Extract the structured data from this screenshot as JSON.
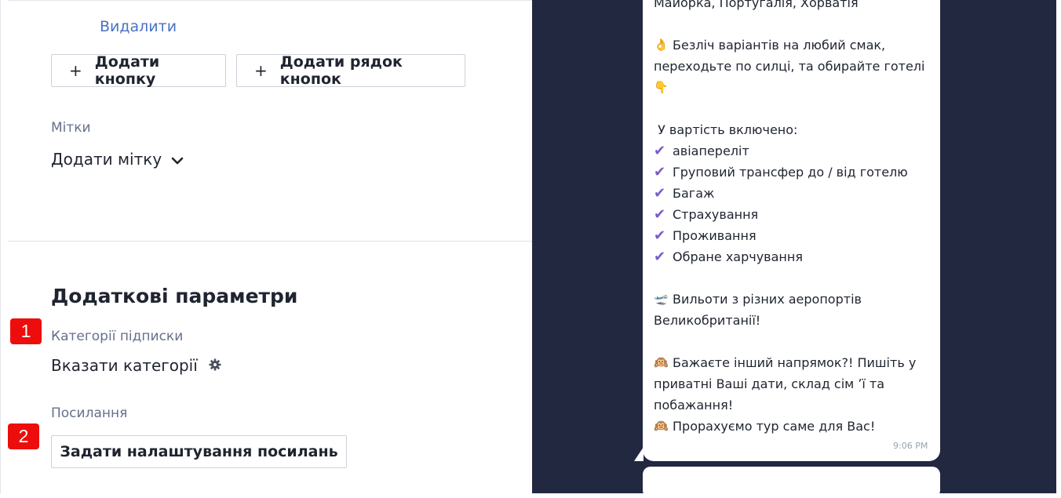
{
  "editor": {
    "delete_link": "Видалити",
    "add_button": "Додати кнопку",
    "add_button_row": "Додати рядок кнопок",
    "tags_label": "Мітки",
    "add_tag": "Додати мітку",
    "section_title": "Додаткові параметри",
    "categories_label": "Категорії підписки",
    "categories_value": "Вказати категорії",
    "links_label": "Посилання",
    "links_button": "Задати налаштування посилань",
    "plus_glyph": "+"
  },
  "badges": [
    "1",
    "2"
  ],
  "preview": {
    "lines": {
      "l0": "Майорка, Португалія, Хорватія",
      "l1_emoji": "👌",
      "l1": "Безліч варіантів на любий смак,",
      "l2": "переходьте по силці, та обирайте готелі",
      "l3_emoji": "👇",
      "l4": " У вартість включено:",
      "items": [
        "авіапереліт",
        "Груповий трансфер до / від готелю",
        "Багаж",
        "Страхування",
        "Проживання",
        "Обране харчування"
      ],
      "l5_emoji": "🛫",
      "l5": "Вильоти з різних аеропортів",
      "l6": "Великобританії!",
      "l7_emoji": "🙉",
      "l7": "Бажаєте інший напрямок?! Пишіть у",
      "l8": "приватні Ваші дати, склад сім ʼї та",
      "l9": "побажання!",
      "l10_emoji": "🙉",
      "l10": "Прорахуємо тур саме для Вас!"
    },
    "check_glyph": "✔",
    "time": "9:06 PM"
  },
  "colors": {
    "preview_bg": "#222840",
    "link": "#4a72c4",
    "badge": "#ee0d0d",
    "check": "#7a5cc8"
  },
  "icons": [
    "plus-icon",
    "chevron-down-icon",
    "gear-icon",
    "check-icon"
  ]
}
